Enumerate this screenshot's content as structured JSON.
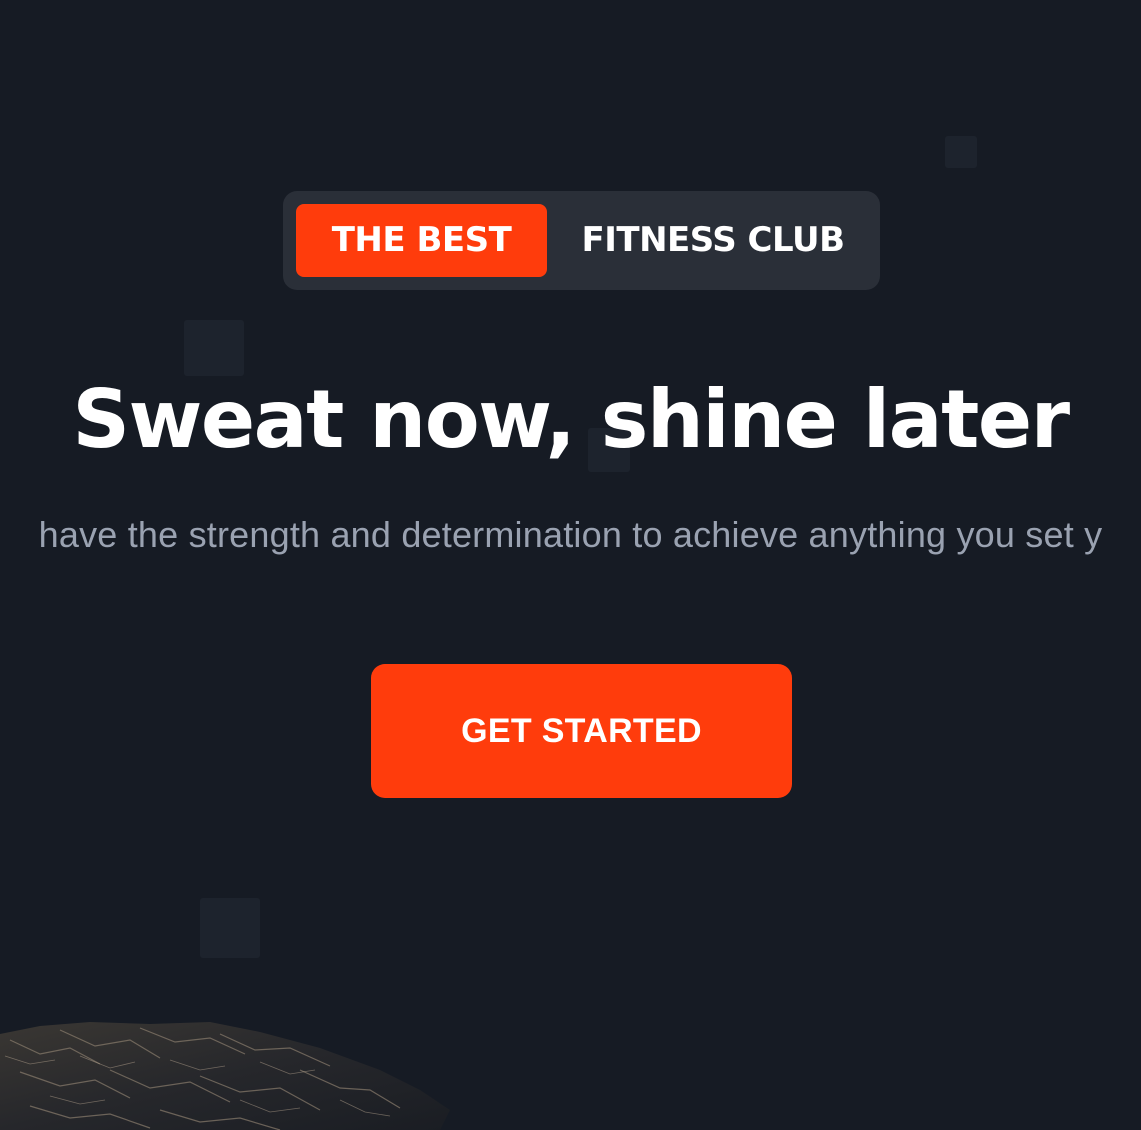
{
  "hero": {
    "tagline": {
      "highlight": "THE BEST",
      "rest": "FITNESS CLUB"
    },
    "headline": "Sweat now, shine later",
    "subtext": "have the strength and determination to achieve anything you set y",
    "cta_label": "GET STARTED"
  },
  "colors": {
    "background": "#161b24",
    "accent": "#ff3c0c",
    "pill_background": "#2a2f38",
    "subtext": "#9aa2b1",
    "text": "#ffffff"
  }
}
